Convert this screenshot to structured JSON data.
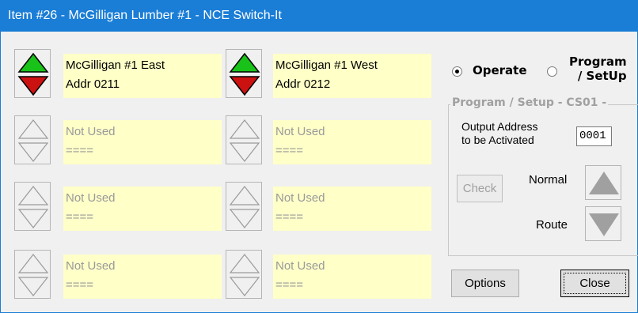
{
  "window": {
    "title": "Item #26 - McGilligan Lumber #1 - NCE Switch-It"
  },
  "switches": [
    {
      "line1": "McGilligan #1 East",
      "line2": "Addr 0211",
      "active": true
    },
    {
      "line1": "McGilligan #1 West",
      "line2": "Addr 0212",
      "active": true
    },
    {
      "line1": "Not Used",
      "line2": "====",
      "active": false
    },
    {
      "line1": "Not Used",
      "line2": "====",
      "active": false
    },
    {
      "line1": "Not Used",
      "line2": "====",
      "active": false
    },
    {
      "line1": "Not Used",
      "line2": "====",
      "active": false
    },
    {
      "line1": "Not Used",
      "line2": "====",
      "active": false
    },
    {
      "line1": "Not Used",
      "line2": "====",
      "active": false
    }
  ],
  "mode": {
    "operate_label": "Operate",
    "program_label_1": "Program",
    "program_label_2": "/ SetUp",
    "selected": "operate"
  },
  "program_setup": {
    "title": "Program / Setup  - CS01 -",
    "output_label_1": "Output Address",
    "output_label_2": "to be Activated",
    "output_value": "0001",
    "check_label": "Check",
    "normal_label": "Normal",
    "route_label": "Route"
  },
  "footer": {
    "options_label": "Options",
    "close_label": "Close"
  },
  "colors": {
    "title_bar": "#1a7dd6",
    "label_bg": "#ffffc8",
    "up_active": "#19c219",
    "down_active": "#cc1111",
    "inactive_arrow": "#9a9a9a"
  }
}
